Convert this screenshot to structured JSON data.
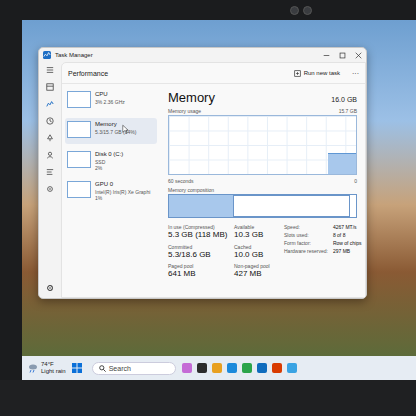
{
  "window": {
    "title": "Task Manager"
  },
  "header": {
    "title": "Performance",
    "run_task": "Run new task",
    "more": "···"
  },
  "sidebar": {
    "items": [
      {
        "name": "CPU",
        "detail": "3% 2.36 GHz",
        "selected": false
      },
      {
        "name": "Memory",
        "detail": "5.3/15.7 GB (34%)",
        "selected": true
      },
      {
        "name": "Disk 0 (C:)",
        "detail": "SSD",
        "extra": "2%",
        "selected": false
      },
      {
        "name": "GPU 0",
        "detail": "Intel(R) Iris(R) Xe Graphi",
        "extra": "1%",
        "selected": false
      }
    ]
  },
  "memory": {
    "title": "Memory",
    "total": "16.0 GB",
    "usage_label": "Memory usage",
    "usage_max": "15.7 GB",
    "usage_values": [
      0,
      0,
      0,
      0,
      0,
      0,
      0,
      0,
      0,
      0,
      0,
      0,
      0,
      0,
      0,
      0,
      0,
      5.3,
      5.3,
      5.3
    ],
    "time_label": "60 seconds",
    "zero_label": "0",
    "composition_label": "Memory composition",
    "in_use_level": 0.34,
    "cached_level": 0.63,
    "stats": [
      {
        "label": "In use (Compressed)",
        "value": "5.3 GB (118 MB)"
      },
      {
        "label": "Available",
        "value": "10.3 GB"
      },
      {
        "label": "Committed",
        "value": "5.3/18.6 GB"
      },
      {
        "label": "Cached",
        "value": "10.0 GB"
      },
      {
        "label": "Paged pool",
        "value": "641 MB"
      },
      {
        "label": "Non-paged pool",
        "value": "427 MB"
      }
    ],
    "specs": [
      {
        "label": "Speed:",
        "value": "4267 MT/s"
      },
      {
        "label": "Slots used:",
        "value": "8 of 8"
      },
      {
        "label": "Form factor:",
        "value": "Row of chips"
      },
      {
        "label": "Hardware reserved:",
        "value": "297 MB"
      }
    ]
  },
  "taskbar": {
    "temperature": "74°F",
    "weather": "Light rain",
    "search": "Search"
  }
}
